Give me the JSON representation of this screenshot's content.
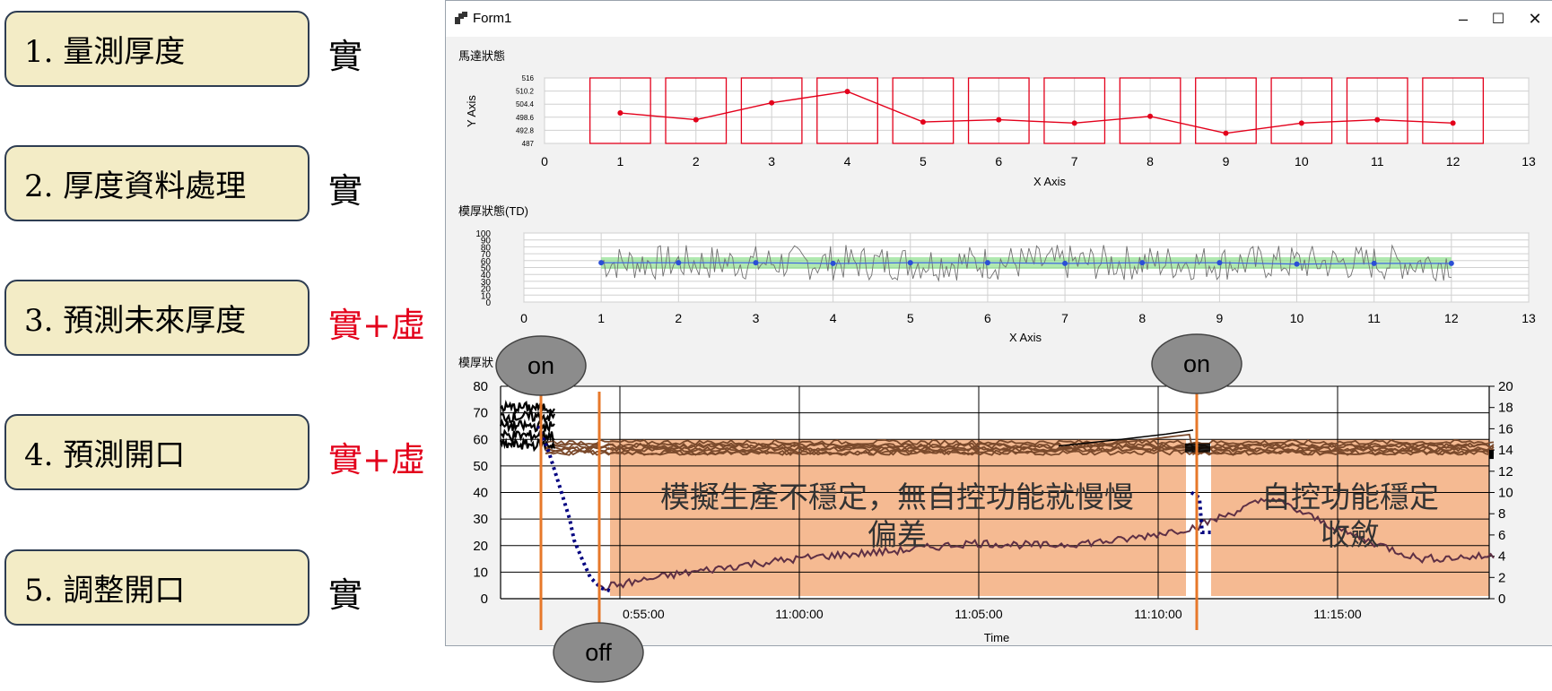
{
  "steps": [
    {
      "label": "1. 量測厚度",
      "tag": "實",
      "tag_color": "#000000"
    },
    {
      "label": "2. 厚度資料處理",
      "tag": "實",
      "tag_color": "#000000"
    },
    {
      "label": "3. 預測未來厚度",
      "tag": "實+虛",
      "tag_color": "#e3001b"
    },
    {
      "label": "4. 預測開口",
      "tag": "實+虛",
      "tag_color": "#e3001b"
    },
    {
      "label": "5. 調整開口",
      "tag": "實",
      "tag_color": "#000000"
    }
  ],
  "window": {
    "title": "Form1",
    "icon": "app-icon",
    "controls": {
      "minimize": "–",
      "maximize": "☐",
      "close": "✕"
    }
  },
  "colors": {
    "step_fill": "#f3ecc6",
    "step_border": "#2e3d52",
    "accent_red": "#e3001b",
    "highlight_orange": "#f4b183",
    "marker_orange": "#e7782a",
    "bubble_gray": "#8c8c8c"
  },
  "chart_data": [
    {
      "type": "bar",
      "title": "馬達狀態",
      "xlabel": "X Axis",
      "ylabel": "Y Axis",
      "xlim": [
        0,
        13
      ],
      "ylim": [
        487,
        516
      ],
      "yticks": [
        "516",
        "510.2",
        "504.4",
        "498.6",
        "492.8",
        "487"
      ],
      "xticks": [
        "0",
        "1",
        "2",
        "3",
        "4",
        "5",
        "6",
        "7",
        "8",
        "9",
        "10",
        "11",
        "12",
        "13"
      ],
      "bars": {
        "x": [
          1,
          2,
          3,
          4,
          5,
          6,
          7,
          8,
          9,
          10,
          11,
          12
        ],
        "values": [
          516,
          516,
          516,
          516,
          516,
          516,
          516,
          516,
          516,
          516,
          516,
          516
        ]
      },
      "line": {
        "x": [
          1,
          2,
          3,
          4,
          5,
          6,
          7,
          8,
          9,
          10,
          11,
          12
        ],
        "values": [
          500.5,
          497.5,
          505,
          510,
          496.5,
          497.5,
          496,
          499,
          491.5,
          496,
          497.5,
          496
        ]
      }
    },
    {
      "type": "line",
      "title": "模厚狀態(TD)",
      "xlabel": "X Axis",
      "xlim": [
        0,
        13
      ],
      "ylim": [
        0,
        100
      ],
      "yticks": [
        "100",
        "90",
        "80",
        "70",
        "60",
        "50",
        "40",
        "30",
        "20",
        "10",
        "0"
      ],
      "xticks": [
        "0",
        "1",
        "2",
        "3",
        "4",
        "5",
        "6",
        "7",
        "8",
        "9",
        "10",
        "11",
        "12",
        "13"
      ],
      "band": [
        48,
        65
      ],
      "markers": {
        "x": [
          1,
          2,
          3,
          4,
          5,
          6,
          7,
          8,
          9,
          10,
          11,
          12
        ],
        "values": [
          57,
          57,
          57,
          56,
          57,
          57,
          56,
          57,
          57,
          55,
          56,
          56
        ]
      },
      "noise_center": 57,
      "noise_amplitude": 40
    },
    {
      "type": "line",
      "title": "模厚狀",
      "xlabel": "Time",
      "ylim_left": [
        0,
        80
      ],
      "ylim_right": [
        0,
        20
      ],
      "yticks_left": [
        "80",
        "70",
        "60",
        "50",
        "40",
        "30",
        "20",
        "10",
        "0"
      ],
      "yticks_right": [
        "20",
        "18",
        "16",
        "14",
        "12",
        "10",
        "8",
        "6",
        "4",
        "2",
        "0"
      ],
      "xticks": [
        "0:55:00",
        "11:00:00",
        "11:05:00",
        "11:10:00",
        "11:15:00"
      ],
      "annotations": [
        {
          "text": "on",
          "kind": "bubble"
        },
        {
          "text": "off",
          "kind": "bubble"
        },
        {
          "text": "on",
          "kind": "bubble"
        },
        {
          "text": "模擬生產不穩定，無自控功能就慢慢偏差",
          "kind": "highlight"
        },
        {
          "text": "自控功能穩定收斂",
          "kind": "highlight"
        }
      ],
      "series": [
        {
          "name": "",
          "color": "#7b4a2c",
          "values_approx": [
            57,
            56,
            57,
            56,
            57,
            56,
            57,
            58,
            60,
            62,
            57,
            56,
            55
          ]
        },
        {
          "name": "",
          "color": "#5e3045",
          "values_approx": [
            4,
            9,
            13,
            16,
            18,
            21,
            20,
            22,
            27,
            38,
            25,
            15,
            16
          ]
        },
        {
          "name": "",
          "color": "#000080",
          "values_approx": [
            65,
            62,
            52,
            40,
            25,
            12,
            4,
            3
          ]
        }
      ]
    }
  ]
}
